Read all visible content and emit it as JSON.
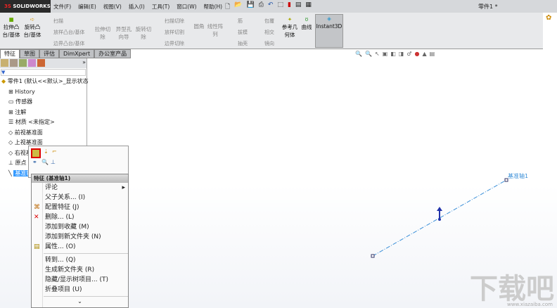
{
  "app": {
    "logo": "SOLIDWORKS",
    "title": "零件1 *"
  },
  "menu": [
    "文件(F)",
    "编辑(E)",
    "视图(V)",
    "插入(I)",
    "工具(T)",
    "窗口(W)",
    "帮助(H)"
  ],
  "ribbon": {
    "extrude_boss": "拉伸凸台/基体",
    "revolve_boss": "旋转凸台/基体",
    "sweep": "扫描",
    "loft_boss": "放样凸台/基体",
    "boundary_boss": "边界凸台/基体",
    "extrude_cut": "拉伸切除",
    "hole_wizard": "异型孔向导",
    "revolve_cut": "旋转切除",
    "sweep_cut": "扫描切除",
    "loft_cut": "放样切割",
    "boundary_cut": "边界切除",
    "fillet": "圆角",
    "linear_pattern": "线性阵列",
    "rib": "筋",
    "draft": "拔模",
    "shell": "抽壳",
    "wrap": "包覆",
    "intersect": "相交",
    "mirror": "镜向",
    "ref_geometry": "参考几何体",
    "curves": "曲线",
    "instant3d": "Instant3D"
  },
  "tabs": [
    "特征",
    "草图",
    "评估",
    "DimXpert",
    "办公室产品"
  ],
  "tree": {
    "root": "零件1 (默认<<默认>_显示状态",
    "items": [
      "History",
      "传感器",
      "注解",
      "材质 <未指定>",
      "前视基准面",
      "上视基准面",
      "右视基准面",
      "原点",
      "基准轴1"
    ]
  },
  "context_menu": {
    "header": "特征 (基准轴1)",
    "items": [
      "评论",
      "父子关系... (I)",
      "配置特征 (J)",
      "删除... (L)",
      "添加到收藏 (M)",
      "添加到新文件夹 (N)",
      "属性... (O)"
    ],
    "items2": [
      "转到... (Q)",
      "生成新文件夹 (R)",
      "隐藏/显示树项目... (T)",
      "折叠项目 (U)"
    ]
  },
  "viewport": {
    "axis_label": "基准轴1"
  },
  "watermark": {
    "text": "下载吧",
    "url": "www.xiazaiba.com"
  }
}
